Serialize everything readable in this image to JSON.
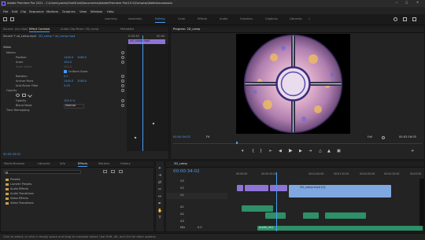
{
  "app": {
    "title": "Adobe Premiere Pro 2021 - C:\\Users\\yashs\\OneDrive\\Documents\\Adobe\\Premiere Pro\\15.0\\Compisp\\Kaleidoscoooooo",
    "colors": {
      "accent": "#4b9df0",
      "clip_purple": "#8e74d6",
      "clip_blue": "#7fa8e0",
      "clip_green": "#2e8f69",
      "playhead": "#4b9df0"
    }
  },
  "menu": [
    "File",
    "Edit",
    "Clip",
    "Sequence",
    "Markers",
    "Graphics",
    "View",
    "Window",
    "Help"
  ],
  "workspaces": [
    "Learning",
    "Assembly",
    "Editing",
    "Color",
    "Effects",
    "Audio",
    "Graphics",
    "Captions",
    "Libraries"
  ],
  "source_panel": {
    "tabs": [
      "Source: (no clips)",
      "Effect Controls",
      "Audio Clip Mixer: 2D_comp",
      "Metadata"
    ],
    "clip_selector": "Source * ud_comp.mp4",
    "sequence_selector": "2D_comp * ud_comp.mp4",
    "ruler_time": "0:00:30",
    "ruler_time2": "00:00",
    "clip_label": "ud_comp.mp4",
    "video_label": "Video",
    "motion": {
      "label": "Motion",
      "position_label": "Position",
      "position_x": "1440.0",
      "position_y": "1080.0",
      "scale_label": "Scale",
      "scale_value": "100.0",
      "scale_width_label": "Scale Width",
      "uniform_scale_label": "Uniform Scale",
      "rotation_label": "Rotation",
      "rotation_value": "0.0",
      "anchor_label": "Anchor Point",
      "anchor_x": "1440.0",
      "anchor_y": "1080.0",
      "antiflicker_label": "Anti-flicker Filter",
      "antiflicker_value": "0.00"
    },
    "opacity": {
      "label": "Opacity",
      "opacity_label": "Opacity",
      "opacity_value": "100.0 %",
      "blend_label": "Blend Mode",
      "blend_value": "Normal"
    },
    "time_remap_label": "Time Remapping",
    "timecode": "00:00:34:02"
  },
  "program": {
    "tab": "Program: 2D_comp",
    "timecode": "00:00:34:02",
    "fit": "Fit",
    "quality": "Full",
    "duration": "00:02:16:05"
  },
  "project": {
    "tabs": [
      "Media Browser",
      "Libraries",
      "Info",
      "Effects",
      "Markers",
      "History"
    ],
    "search_placeholder": "",
    "folders": [
      "Presets",
      "Lumetri Presets",
      "Audio Effects",
      "Audio Transitions",
      "Video Effects",
      "Video Transitions"
    ]
  },
  "timeline": {
    "tab": "2D_comp",
    "timecode": "00:00:34:02",
    "ruler": [
      "00:00:00",
      "00:00:30:00",
      "00:01:00:00",
      "00:01:30:00",
      "00:02:00:00",
      "00:02:30:00",
      "00:03:00"
    ],
    "tracks": [
      "V3",
      "V2",
      "V1",
      "A1",
      "A2",
      "A3",
      "Mix"
    ],
    "video_clip_label": "2D_comp.mp4 [V]",
    "audio_clip_label": "audio_mix",
    "mix_value": "0.0"
  },
  "status": {
    "text": "Click to select, or click in empty space and drag to marquee select. Use Shift, Alt, and Ctrl for other options."
  },
  "chart_data": null
}
